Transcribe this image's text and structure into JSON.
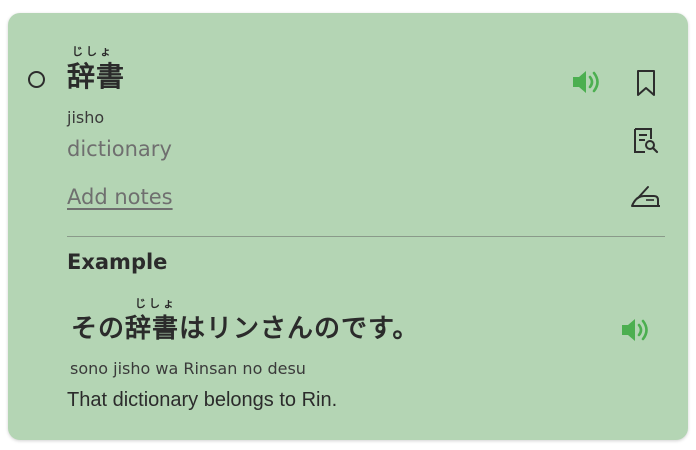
{
  "entry": {
    "furigana": "じしょ",
    "word": "辞書",
    "romaji": "jisho",
    "meaning": "dictionary",
    "add_notes_label": "Add notes"
  },
  "example": {
    "section_title": "Example",
    "furigana": "じしょ",
    "sentence_prefix": "その",
    "sentence_kanji": "辞書",
    "sentence_suffix": "はリンさんのです。",
    "romaji": "sono jisho wa Rinsan no desu",
    "translation": "That dictionary belongs to Rin."
  },
  "colors": {
    "card_background": "#b4d5b4",
    "audio_icon": "#4caf50",
    "text_primary": "#2b2b2b",
    "text_secondary": "#6f6f6f"
  },
  "icons": [
    "radio-circle-icon",
    "speaker-icon",
    "bookmark-icon",
    "document-search-icon",
    "edit-notes-icon",
    "speaker-icon"
  ]
}
